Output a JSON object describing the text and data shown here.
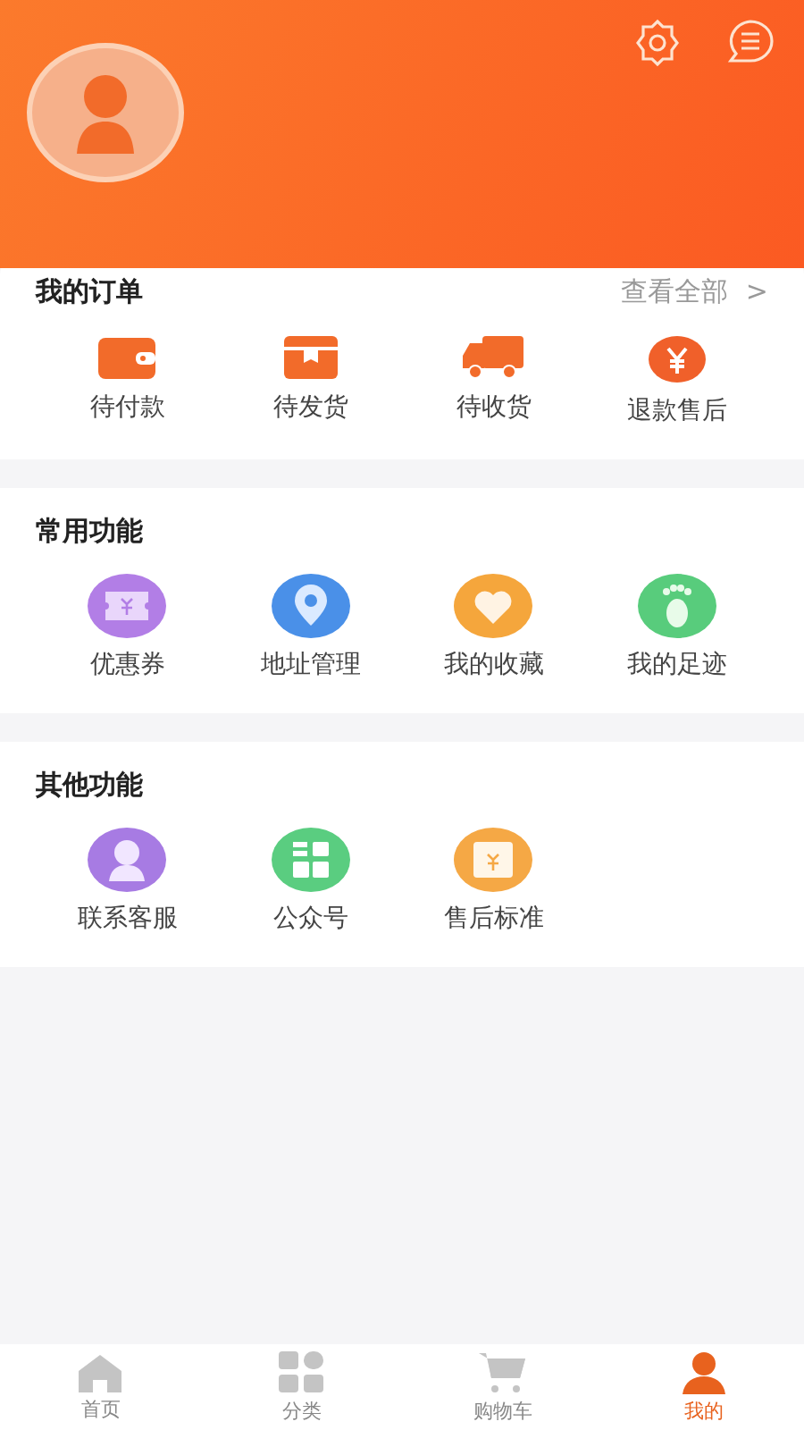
{
  "orders": {
    "title": "我的订单",
    "view_all": "查看全部",
    "view_all_arrow": ">",
    "items": [
      {
        "label": "待付款"
      },
      {
        "label": "待发货"
      },
      {
        "label": "待收货"
      },
      {
        "label": "退款售后"
      }
    ]
  },
  "sections": [
    {
      "title": "常用功能",
      "items": [
        {
          "label": "优惠券",
          "color": "#b27ee6"
        },
        {
          "label": "地址管理",
          "color": "#4a90e8"
        },
        {
          "label": "我的收藏",
          "color": "#f5a63c"
        },
        {
          "label": "我的足迹",
          "color": "#58cc7c"
        }
      ]
    },
    {
      "title": "其他功能",
      "items": [
        {
          "label": "联系客服",
          "color": "#a77be3"
        },
        {
          "label": "公众号",
          "color": "#5acd80"
        },
        {
          "label": "售后标准",
          "color": "#f5a845"
        }
      ]
    }
  ],
  "tab_bar": [
    {
      "label": "首页",
      "selected": false
    },
    {
      "label": "分类",
      "selected": false
    },
    {
      "label": "购物车",
      "selected": false
    },
    {
      "label": "我的",
      "selected": true
    }
  ]
}
